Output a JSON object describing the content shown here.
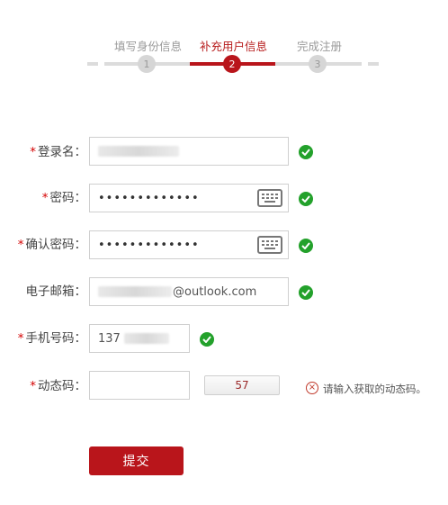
{
  "steps": [
    {
      "label": "填写身份信息",
      "number": "1"
    },
    {
      "label": "补充用户信息",
      "number": "2"
    },
    {
      "label": "完成注册",
      "number": "3"
    }
  ],
  "colors": {
    "accent": "#b9151b",
    "success": "#23a12b",
    "error": "#c0392b"
  },
  "form": {
    "required_mark": "*",
    "username": {
      "label": "登录名：",
      "value": "",
      "valid": true
    },
    "password": {
      "label": "密码：",
      "value": "•••••••••••••",
      "valid": true
    },
    "confirm_password": {
      "label": "确认密码：",
      "value": "•••••••••••••",
      "valid": true
    },
    "email": {
      "label": "电子邮箱：",
      "value": "@outlook.com",
      "valid": true
    },
    "phone": {
      "label": "手机号码：",
      "value": "137",
      "valid": true
    },
    "code": {
      "label": "动态码：",
      "value": "",
      "button_label": "57",
      "error": "请输入获取的动态码。"
    }
  },
  "submit_label": "提交",
  "icons": {
    "keyboard": "keyboard-icon",
    "check": "check-circle-icon",
    "error": "error-circle-icon"
  }
}
